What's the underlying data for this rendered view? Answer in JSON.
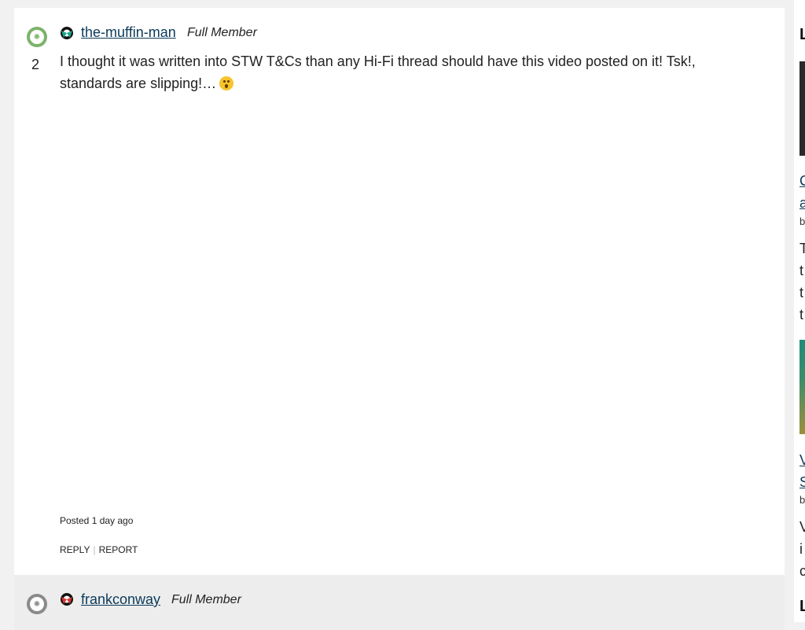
{
  "post1": {
    "username": "the-muffin-man",
    "role": "Full Member",
    "count": "2",
    "body": "I thought it was written into STW T&Cs than any Hi-Fi thread should have this video posted on it! Tsk!,",
    "body_line2": "standards are slipping!…",
    "emoji": "smiling-face-emoji",
    "posted": "Posted 1 day ago",
    "reply_label": "REPLY",
    "report_label": "REPORT"
  },
  "post2": {
    "username": "frankconway",
    "role": "Full Member"
  },
  "sidebar": {
    "heading1": "L",
    "link1_line1": "C",
    "link1_line2": "a",
    "meta1": "b",
    "text1": [
      "T",
      "t",
      "t",
      "t"
    ],
    "link2_line1": "V",
    "link2_line2": "S",
    "meta2": "b",
    "text2": [
      "V",
      "i",
      "c"
    ],
    "heading2": "L"
  },
  "colors": {
    "link": "#0b3a5a",
    "avatar_green": "#7cb36a",
    "avatar_grey": "#8a8a8a",
    "page_bg": "#f1f1f1"
  }
}
